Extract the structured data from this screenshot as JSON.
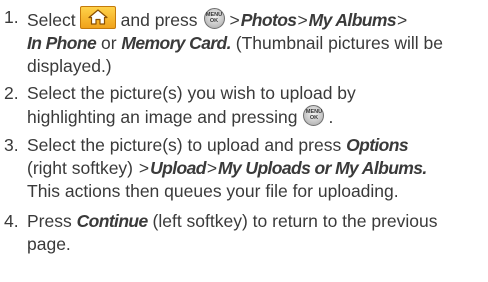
{
  "steps": [
    {
      "number": "1.",
      "select_label": "Select",
      "and_press_label": "and press",
      "path": [
        "Photos",
        "My Albums",
        "In Phone"
      ],
      "or_label": "or",
      "memory_card_label": "Memory Card.",
      "paren_note": "(Thumbnail pictures will be",
      "paren_note_end": "displayed.)"
    },
    {
      "number": "2.",
      "line1": "Select the picture(s) you wish to upload by",
      "line2": "highlighting an image and pressing",
      "line2_end": "."
    },
    {
      "number": "3.",
      "line1_start": "Select the picture(s) to upload and press",
      "options_label": "Options",
      "right_softkey_label": "(right softkey)",
      "upload_label": "Upload",
      "uploads_label": "My Uploads or My Albums.",
      "line3": "This actions then queues your file for uploading."
    },
    {
      "number": "4.",
      "press_label": "Press",
      "continue_label": "Continue",
      "line1_rest": "(left softkey) to return to the previous",
      "line2": "page."
    }
  ],
  "icons": {
    "home": "home-icon",
    "menu_ok": "menu-ok-key-icon",
    "menu_ok_top": "MENU",
    "menu_ok_bottom": "OK",
    "home_color": "#f5b324"
  },
  "separator": ">"
}
